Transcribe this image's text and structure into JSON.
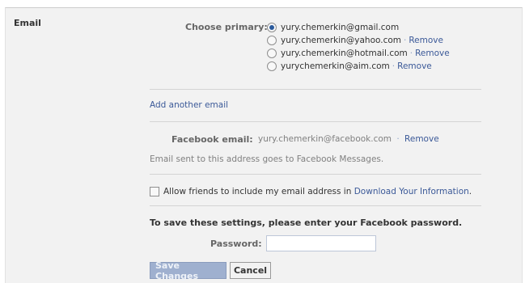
{
  "section": {
    "label": "Email"
  },
  "primary": {
    "label": "Choose primary:",
    "options": [
      {
        "address": "yury.chemerkin@gmail.com",
        "remove": ""
      },
      {
        "address": "yury.chemerkin@yahoo.com",
        "remove": "Remove"
      },
      {
        "address": "yury.chemerkin@hotmail.com",
        "remove": "Remove"
      },
      {
        "address": "yurychemerkin@aim.com",
        "remove": "Remove"
      }
    ],
    "separator": "·"
  },
  "add_email": {
    "label": "Add another email"
  },
  "facebook_email": {
    "label": "Facebook email:",
    "address": "yury.chemerkin@facebook.com",
    "remove": "Remove",
    "note": "Email sent to this address goes to Facebook Messages."
  },
  "allow_friends": {
    "text": "Allow friends to include my email address in ",
    "link": "Download Your Information",
    "suffix": "."
  },
  "password_prompt": {
    "text": "To save these settings, please enter your Facebook password.",
    "password_label": "Password:",
    "password_value": ""
  },
  "buttons": {
    "save": "Save Changes",
    "cancel": "Cancel"
  }
}
